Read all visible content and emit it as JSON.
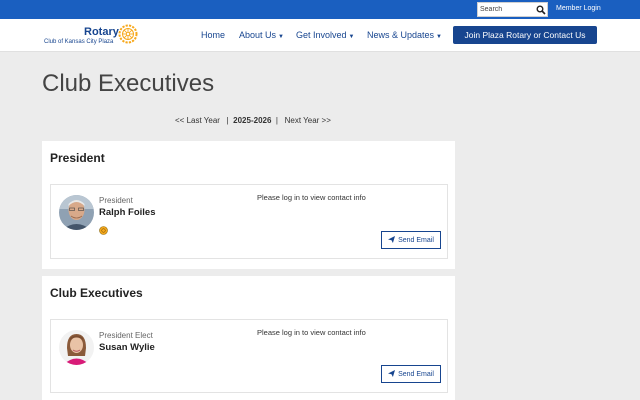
{
  "topbar": {
    "search_placeholder": "Search",
    "member_login": "Member Login"
  },
  "header": {
    "logo_word": "Rotary",
    "logo_sub": "Club of Kansas City Plaza",
    "nav": [
      {
        "label": "Home"
      },
      {
        "label": "About Us"
      },
      {
        "label": "Get Involved"
      },
      {
        "label": "News & Updates"
      }
    ],
    "cta": "Join Plaza Rotary or Contact Us"
  },
  "page": {
    "title": "Club Executives",
    "year_nav": {
      "prev": "<< Last Year",
      "current": "2025-2026",
      "next": "Next Year >>"
    }
  },
  "sections": [
    {
      "title": "President",
      "member": {
        "role": "President",
        "name": "Ralph Foiles",
        "contact_note": "Please log in to view contact info",
        "send_email": "Send Email"
      }
    },
    {
      "title": "Club Executives",
      "member": {
        "role": "President Elect",
        "name": "Susan Wylie",
        "contact_note": "Please log in to view contact info",
        "send_email": "Send Email"
      }
    }
  ],
  "colors": {
    "brand_blue": "#17458f",
    "topbar_blue": "#1a5fc0",
    "rotary_gold": "#f7a81b"
  }
}
